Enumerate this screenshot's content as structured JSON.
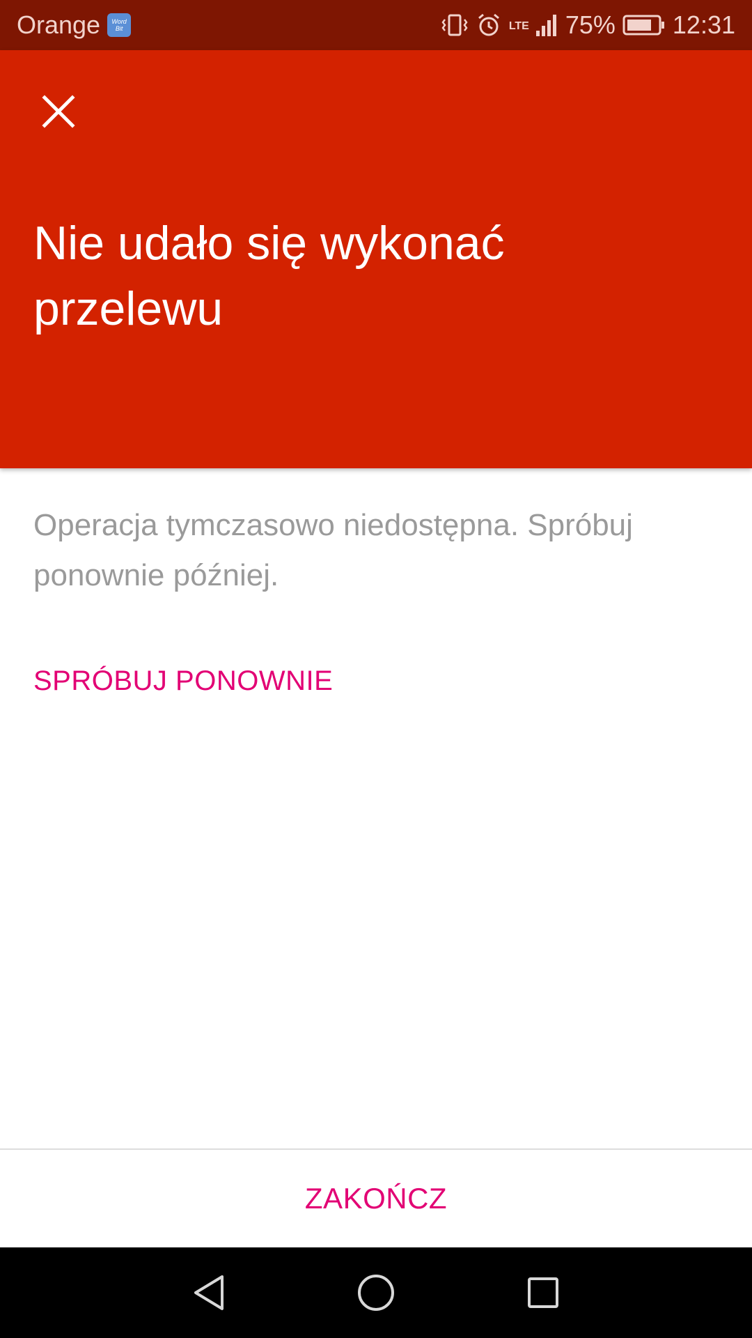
{
  "status_bar": {
    "carrier": "Orange",
    "app_badge_line1": "Word",
    "app_badge_line2": "Bit",
    "network_type": "LTE",
    "battery_percent": "75%",
    "time": "12:31"
  },
  "header": {
    "title": "Nie udało się wykonać przelewu",
    "background_color": "#d32200"
  },
  "body": {
    "message": "Operacja tymczasowo niedostępna. Spróbuj ponownie później.",
    "retry_label": "SPRÓBUJ PONOWNIE"
  },
  "footer": {
    "finish_label": "ZAKOŃCZ"
  },
  "colors": {
    "accent": "#e20074",
    "status_bar": "#7e1602"
  },
  "icons": {
    "close": "close-icon",
    "back": "back-icon",
    "home": "home-icon",
    "recents": "recents-icon"
  }
}
